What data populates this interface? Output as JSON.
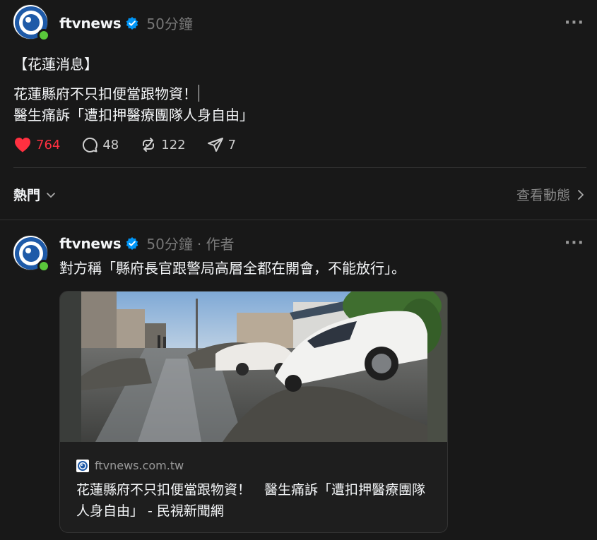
{
  "post1": {
    "username": "ftvnews",
    "time": "50分鐘",
    "lines": [
      "【花蓮消息】",
      "花蓮縣府不只扣便當跟物資！",
      "醫生痛訴「遭扣押醫療團隊人身自由」"
    ],
    "actions": {
      "likes": "764",
      "comments": "48",
      "reposts": "122",
      "shares": "7"
    }
  },
  "hot_section": {
    "label": "熱門",
    "view_activity": "查看動態"
  },
  "post2": {
    "username": "ftvnews",
    "time": "50分鐘",
    "author_tag": "· 作者",
    "text": "對方稱「縣府長官跟警局高層全都在開會，不能放行」。",
    "card": {
      "domain": "ftvnews.com.tw",
      "title": "花蓮縣府不只扣便當跟物資！　醫生痛訴「遭扣押醫療團隊人身自由」 - 民視新聞網"
    }
  },
  "icons": {
    "avatar": "ftvnews-logo-icon",
    "verified": "verified-badge-icon",
    "more": "more-horizontal-icon",
    "like": "heart-icon",
    "comment": "comment-icon",
    "repost": "repost-icon",
    "share": "share-icon",
    "chevron_down": "chevron-down-icon",
    "chevron_right": "chevron-right-icon"
  },
  "colors": {
    "background": "#181818",
    "liked": "#ff3040",
    "verified": "#0095f6",
    "online": "#5ac83b",
    "logo_blue": "#1e5aa8"
  }
}
